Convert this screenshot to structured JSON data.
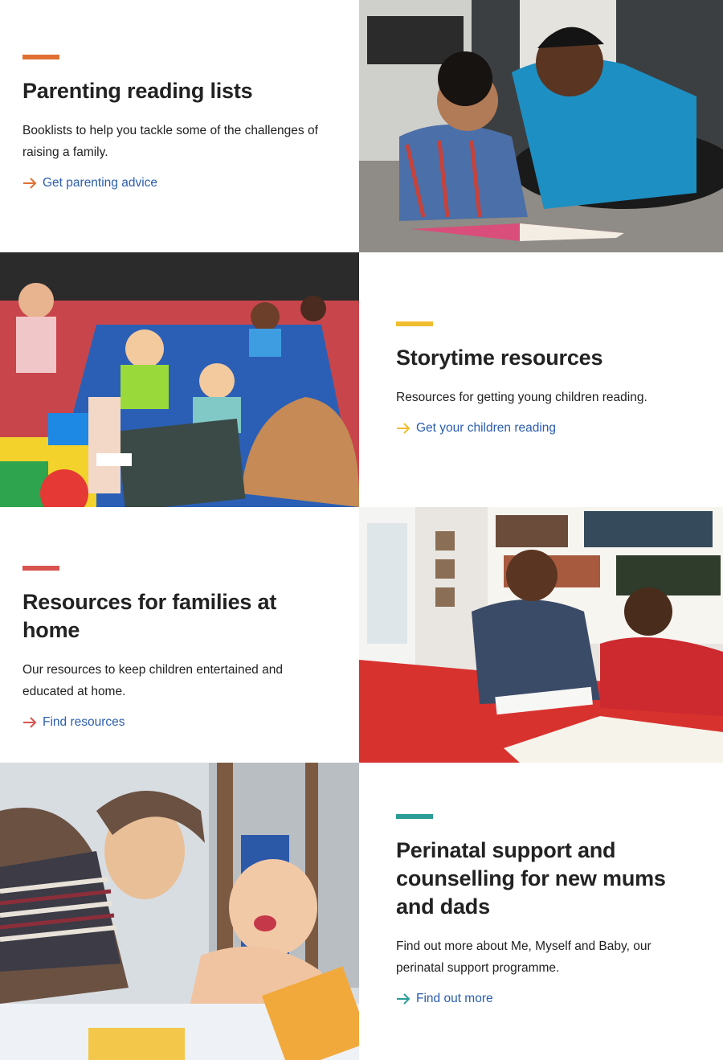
{
  "cards": [
    {
      "title": "Parenting reading lists",
      "description": "Booklists to help you tackle some of the challenges of raising a family.",
      "link": "Get parenting advice",
      "accent": "#e07032",
      "image_alt": "Father and son reading a book on the floor"
    },
    {
      "title": "Storytime resources",
      "description": "Resources for getting young children reading.",
      "link": "Get your children reading",
      "accent": "#f2be2f",
      "image_alt": "Children sitting on a colourful rug during storytime"
    },
    {
      "title": "Resources for families at home",
      "description": "Our resources to keep children entertained and educated at home.",
      "link": "Find resources",
      "accent": "#d9534f",
      "image_alt": "Father helping son with homework at a red table"
    },
    {
      "title": "Perinatal support and counselling for new mums and dads",
      "description": "Find out more about Me, Myself and Baby, our perinatal support programme.",
      "link": "Find out more",
      "accent": "#2a9d96",
      "image_alt": "Mother smiling at laughing baby"
    }
  ],
  "colors": {
    "link": "#2a5db0",
    "text": "#222222"
  }
}
